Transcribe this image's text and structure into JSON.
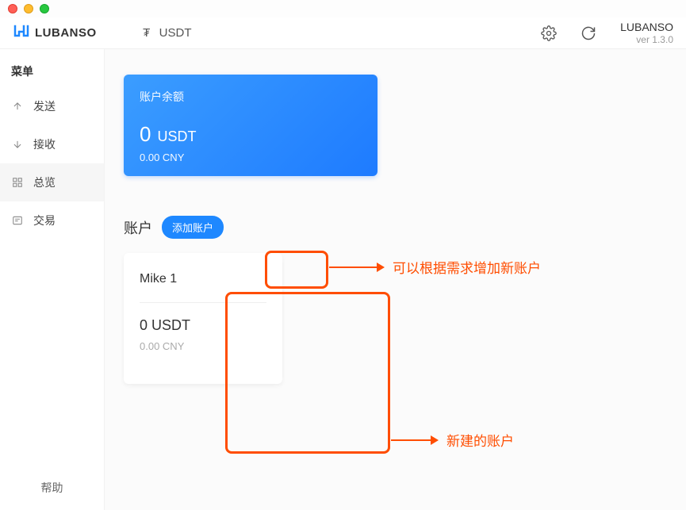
{
  "app": {
    "name": "LUBANSO",
    "version": "ver 1.3.0"
  },
  "topbar": {
    "currency_symbol": "₮",
    "currency_label": "USDT"
  },
  "sidebar": {
    "menu_title": "菜单",
    "items": [
      {
        "label": "发送"
      },
      {
        "label": "接收"
      },
      {
        "label": "总览"
      },
      {
        "label": "交易"
      }
    ],
    "help_label": "帮助"
  },
  "balance": {
    "title": "账户余额",
    "amount": "0",
    "unit": "USDT",
    "fiat": "0.00 CNY"
  },
  "accounts": {
    "section_label": "账户",
    "add_button": "添加账户",
    "list": [
      {
        "name": "Mike 1",
        "balance": "0 USDT",
        "fiat": "0.00 CNY"
      }
    ]
  },
  "annotations": {
    "add_hint": "可以根据需求增加新账户",
    "new_account_hint": "新建的账户"
  }
}
